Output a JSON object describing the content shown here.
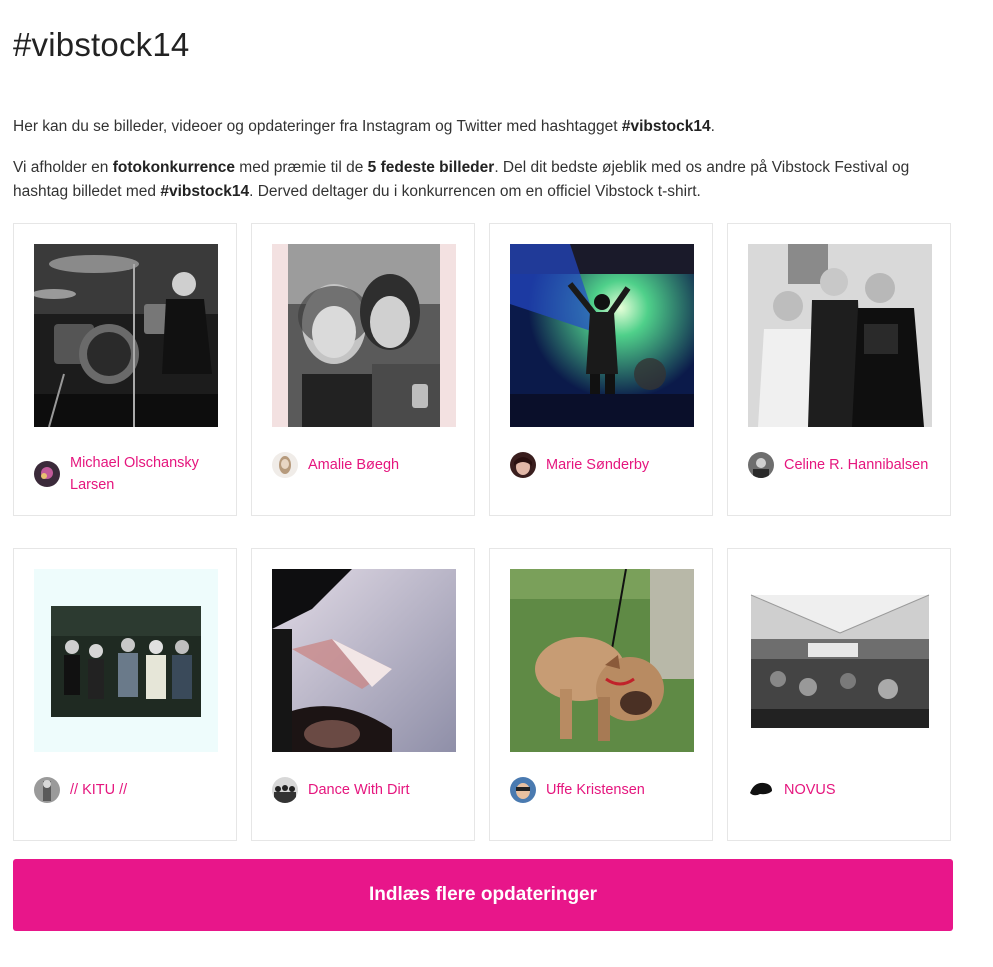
{
  "header": {
    "title": "#vibstock14"
  },
  "intro": {
    "p1_text": "Her kan du se billeder, videoer og opdateringer fra Instagram og Twitter med hashtagget ",
    "p1_bold": "#vibstock14",
    "p1_end": ".",
    "p2_a": "Vi afholder en ",
    "p2_b": "fotokonkurrence",
    "p2_c": " med præmie til de ",
    "p2_d": "5 fedeste billeder",
    "p2_e": ". Del dit bedste øjeblik med os andre på Vibstock Festival og hashtag billedet med ",
    "p2_f": "#vibstock14",
    "p2_g": ". Derved deltager du i konkurrencen om en officiel Vibstock t-shirt."
  },
  "feed": {
    "items": [
      {
        "author": "Michael Olschansky Larsen",
        "photo_icon": "drummer-photo"
      },
      {
        "author": "Amalie Bøegh",
        "photo_icon": "selfie-photo"
      },
      {
        "author": "Marie Sønderby",
        "photo_icon": "stage-photo"
      },
      {
        "author": "Celine R. Hannibalsen",
        "photo_icon": "group-photo"
      },
      {
        "author": "// KITU //",
        "photo_icon": "band-photo"
      },
      {
        "author": "Dance With Dirt",
        "photo_icon": "tent-photo"
      },
      {
        "author": "Uffe Kristensen",
        "photo_icon": "dog-photo"
      },
      {
        "author": "NOVUS",
        "photo_icon": "concert-photo"
      }
    ]
  },
  "load_more": {
    "label": "Indlæs flere opdateringer"
  },
  "colors": {
    "accent": "#e8168a",
    "link": "#e5167e",
    "border": "#e6e6e6"
  }
}
